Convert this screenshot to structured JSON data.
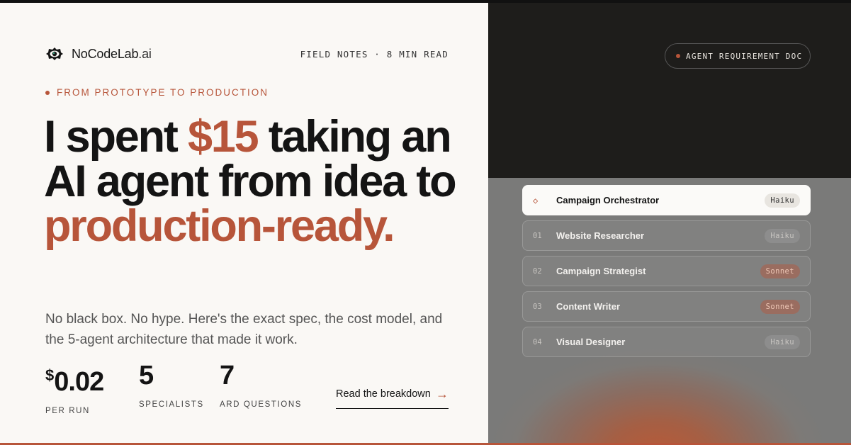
{
  "brand": {
    "name": "NoCodeLab",
    "domain_suffix": ".ai",
    "logo_icon": "eye-gear-icon"
  },
  "header": {
    "meta": "FIELD NOTES · 8 MIN READ"
  },
  "eyebrow": "FROM PROTOTYPE TO PRODUCTION",
  "headline": {
    "part1": "I spent ",
    "accent1": "$15",
    "part2": " taking an AI agent from idea to ",
    "accent2": "production-ready."
  },
  "subhead": "No black box. No hype. Here's the exact spec, the cost model, and the 5-agent architecture that made it work.",
  "stats": [
    {
      "currency": "$",
      "value": "0.02",
      "label": "PER RUN"
    },
    {
      "currency": "",
      "value": "5",
      "label": "SPECIALISTS"
    },
    {
      "currency": "",
      "value": "7",
      "label": "ARD QUESTIONS"
    }
  ],
  "cta": {
    "label": "Read the breakdown",
    "icon": "arrow-right-icon"
  },
  "doc_pill": "AGENT REQUIREMENT DOC",
  "agents": [
    {
      "index": "◇",
      "name": "Campaign Orchestrator",
      "model": "Haiku",
      "model_type": "haiku",
      "active": true
    },
    {
      "index": "01",
      "name": "Website Researcher",
      "model": "Haiku",
      "model_type": "haiku",
      "active": false
    },
    {
      "index": "02",
      "name": "Campaign Strategist",
      "model": "Sonnet",
      "model_type": "sonnet",
      "active": false
    },
    {
      "index": "03",
      "name": "Content Writer",
      "model": "Sonnet",
      "model_type": "sonnet",
      "active": false
    },
    {
      "index": "04",
      "name": "Visual Designer",
      "model": "Haiku",
      "model_type": "haiku",
      "active": false
    }
  ],
  "colors": {
    "accent": "#b7553a",
    "ink": "#141414",
    "paper": "#faf8f5",
    "dark_panel": "#1e1d1b"
  }
}
